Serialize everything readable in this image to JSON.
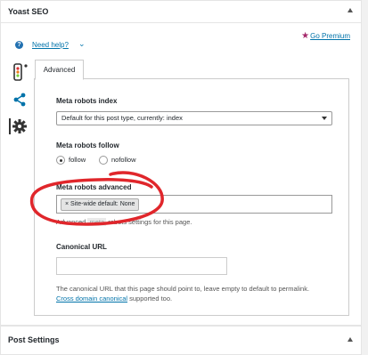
{
  "panel": {
    "title": "Yoast SEO"
  },
  "help": {
    "icon": "question-icon",
    "link_label": "Need help?"
  },
  "premium": {
    "label": "Go Premium",
    "color": "#a4286a"
  },
  "tabs": [
    {
      "label": "Advanced"
    }
  ],
  "fields": {
    "robots_index": {
      "label": "Meta robots index",
      "value": "Default for this post type, currently: index"
    },
    "robots_follow": {
      "label": "Meta robots follow",
      "options": [
        {
          "label": "follow",
          "selected": true
        },
        {
          "label": "nofollow",
          "selected": false
        }
      ]
    },
    "robots_advanced": {
      "label": "Meta robots advanced",
      "chip": "Site-wide default: None",
      "hint_prefix": "Advanced",
      "hint_code": "meta",
      "hint_suffix": "robots settings for this page."
    },
    "canonical": {
      "label": "Canonical URL",
      "value": "",
      "description_1": "The canonical URL that this page should point to, leave empty to default to permalink.",
      "link": "Cross domain canonical",
      "description_2": "supported too."
    }
  },
  "post_settings": {
    "title": "Post Settings"
  },
  "colors": {
    "accent": "#0073aa",
    "annotation": "#e0262b"
  }
}
